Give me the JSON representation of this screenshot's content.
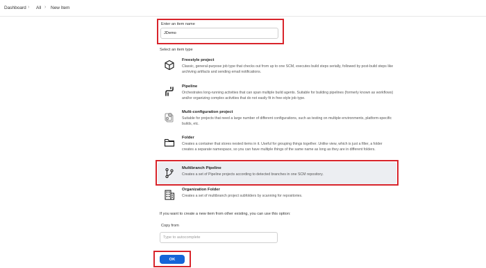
{
  "breadcrumb": {
    "items": [
      "Dashboard",
      "All",
      "New Item"
    ],
    "separator": "›"
  },
  "item_name": {
    "label": "Enter an item name",
    "value": "JDemo"
  },
  "item_type": {
    "label": "Select an item type",
    "options": [
      {
        "name": "Freestyle project",
        "icon": "freestyle-cube-icon",
        "description": "Classic, general-purpose job type that checks out from up to one SCM, executes build steps serially, followed by post-build steps like archiving artifacts and sending email notifications."
      },
      {
        "name": "Pipeline",
        "icon": "pipeline-icon",
        "description": "Orchestrates long-running activities that can span multiple build agents. Suitable for building pipelines (formerly known as workflows) and/or organizing complex activities that do not easily fit in free-style job type."
      },
      {
        "name": "Multi-configuration project",
        "icon": "multi-configuration-icon",
        "description": "Suitable for projects that need a large number of different configurations, such as testing on multiple environments, platform-specific builds, etc."
      },
      {
        "name": "Folder",
        "icon": "folder-icon",
        "description": "Creates a container that stores nested items in it. Useful for grouping things together. Unlike view, which is just a filter, a folder creates a separate namespace, so you can have multiple things of the same name as long as they are in different folders."
      },
      {
        "name": "Multibranch Pipeline",
        "icon": "branch-icon",
        "selected": true,
        "description": "Creates a set of Pipeline projects according to detected branches in one SCM repository."
      },
      {
        "name": "Organization Folder",
        "icon": "organization-building-icon",
        "description": "Creates a set of multibranch project subfolders by scanning for repositories."
      }
    ]
  },
  "copy_from": {
    "hint": "If you want to create a new item from other existing, you can use this option:",
    "label": "Copy from",
    "placeholder": "Type to autocomplete"
  },
  "ok_button": {
    "label": "OK"
  },
  "colors": {
    "highlight_border": "#d8232a",
    "primary_button": "#1565d8",
    "selected_row": "#eceef2"
  }
}
